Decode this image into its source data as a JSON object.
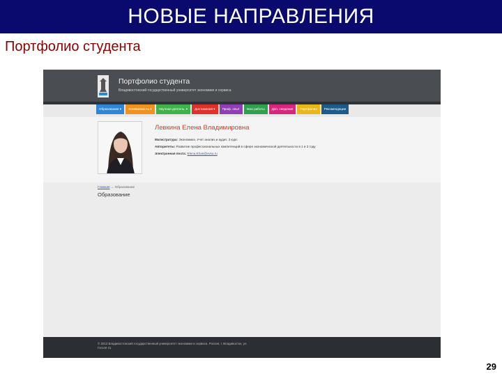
{
  "slide": {
    "header": "НОВЫЕ НАПРАВЛЕНИЯ",
    "subtitle": "Портфолио студента",
    "page_number": "29"
  },
  "site": {
    "title": "Портфолио студента",
    "subtitle": "Владивостокский государственный университет экономики и сервиса",
    "nav": [
      {
        "label": "Образование ▾",
        "color": "#2f86d6"
      },
      {
        "label": "Успеваемость ▾",
        "color": "#f0931e"
      },
      {
        "label": "Научная деятель. ▾",
        "color": "#3fb24a"
      },
      {
        "label": "Достижения ▾",
        "color": "#e0302a"
      },
      {
        "label": "Проф. опыт",
        "color": "#8e3fb3"
      },
      {
        "label": "Мои работы",
        "color": "#2fa04e"
      },
      {
        "label": "Доп. сведения",
        "color": "#d8267e"
      },
      {
        "label": "Портфолио",
        "color": "#e8b81a"
      },
      {
        "label": "Рекомендации",
        "color": "#1d5a8a"
      }
    ],
    "profile": {
      "name": "Левкина Елена Владимировна",
      "program_label": "Магистратура:",
      "program_value": "Экономика. Учет анализ и аудит. 2 курс",
      "thesis_label": "Авторитеты:",
      "thesis_value": "Развитие профессиональных компетенций в сфере экономической деятельности в 1 и 2 году",
      "email_label": "Электронная почта:",
      "email_value": "Elena.Khan@vvsu.ru"
    },
    "breadcrumb": {
      "home": "Главная",
      "separator": "→",
      "current": "Образование"
    },
    "content_heading": "Образование",
    "footer_text": "© 2013 Владивостокский государственный университет экономики и сервиса. Россия, г. Владивосток, ул. Гоголя 41"
  }
}
